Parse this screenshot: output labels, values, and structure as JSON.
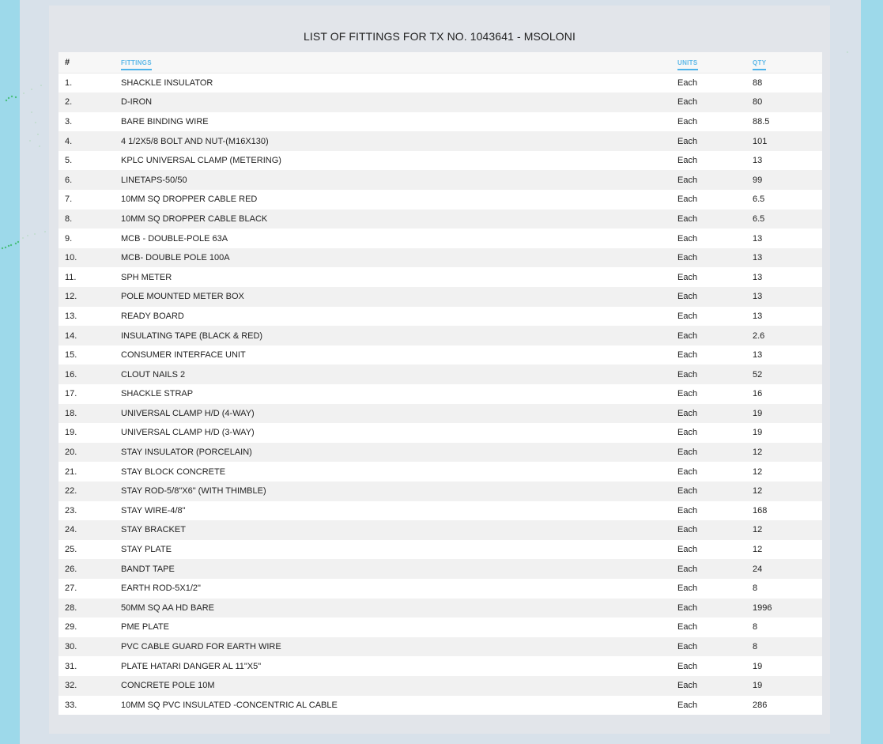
{
  "page": {
    "title": "LIST OF FITTINGS FOR TX NO. 1043641 - MSOLONI"
  },
  "colors": {
    "outer_background": "#9dd9ea",
    "frame_background": "#d8e1ea",
    "panel_background": "#e2e5ea",
    "header_link": "#5db8e8",
    "row_alt": "#f1f1f1"
  },
  "table": {
    "columns": {
      "num": "#",
      "fittings": "FITTINGS",
      "units": "UNITS",
      "qty": "QTY"
    },
    "rows": [
      {
        "num": "1.",
        "fitting": "SHACKLE INSULATOR",
        "unit": "Each",
        "qty": "88"
      },
      {
        "num": "2.",
        "fitting": "D-IRON",
        "unit": "Each",
        "qty": "80"
      },
      {
        "num": "3.",
        "fitting": "BARE BINDING WIRE",
        "unit": "Each",
        "qty": "88.5"
      },
      {
        "num": "4.",
        "fitting": "4 1/2X5/8 BOLT AND NUT-(M16X130)",
        "unit": "Each",
        "qty": "101"
      },
      {
        "num": "5.",
        "fitting": "KPLC UNIVERSAL CLAMP (METERING)",
        "unit": "Each",
        "qty": "13"
      },
      {
        "num": "6.",
        "fitting": "LINETAPS-50/50",
        "unit": "Each",
        "qty": "99"
      },
      {
        "num": "7.",
        "fitting": "10MM SQ DROPPER CABLE RED",
        "unit": "Each",
        "qty": "6.5"
      },
      {
        "num": "8.",
        "fitting": "10MM SQ DROPPER CABLE BLACK",
        "unit": "Each",
        "qty": "6.5"
      },
      {
        "num": "9.",
        "fitting": "MCB - DOUBLE-POLE 63A",
        "unit": "Each",
        "qty": "13"
      },
      {
        "num": "10.",
        "fitting": "MCB- DOUBLE POLE 100A",
        "unit": "Each",
        "qty": "13"
      },
      {
        "num": "11.",
        "fitting": "SPH METER",
        "unit": "Each",
        "qty": "13"
      },
      {
        "num": "12.",
        "fitting": "POLE MOUNTED METER BOX",
        "unit": "Each",
        "qty": "13"
      },
      {
        "num": "13.",
        "fitting": "READY BOARD",
        "unit": "Each",
        "qty": "13"
      },
      {
        "num": "14.",
        "fitting": "INSULATING TAPE (BLACK & RED)",
        "unit": "Each",
        "qty": "2.6"
      },
      {
        "num": "15.",
        "fitting": "CONSUMER INTERFACE UNIT",
        "unit": "Each",
        "qty": "13"
      },
      {
        "num": "16.",
        "fitting": "CLOUT NAILS 2",
        "unit": "Each",
        "qty": "52"
      },
      {
        "num": "17.",
        "fitting": "SHACKLE STRAP",
        "unit": "Each",
        "qty": "16"
      },
      {
        "num": "18.",
        "fitting": "UNIVERSAL CLAMP H/D (4-WAY)",
        "unit": "Each",
        "qty": "19"
      },
      {
        "num": "19.",
        "fitting": "UNIVERSAL CLAMP H/D (3-WAY)",
        "unit": "Each",
        "qty": "19"
      },
      {
        "num": "20.",
        "fitting": "STAY INSULATOR (PORCELAIN)",
        "unit": "Each",
        "qty": "12"
      },
      {
        "num": "21.",
        "fitting": "STAY BLOCK CONCRETE",
        "unit": "Each",
        "qty": "12"
      },
      {
        "num": "22.",
        "fitting": "STAY ROD-5/8\"X6\" (WITH THIMBLE)",
        "unit": "Each",
        "qty": "12"
      },
      {
        "num": "23.",
        "fitting": "STAY WIRE-4/8\"",
        "unit": "Each",
        "qty": "168"
      },
      {
        "num": "24.",
        "fitting": "STAY BRACKET",
        "unit": "Each",
        "qty": "12"
      },
      {
        "num": "25.",
        "fitting": "STAY PLATE",
        "unit": "Each",
        "qty": "12"
      },
      {
        "num": "26.",
        "fitting": "BANDT TAPE",
        "unit": "Each",
        "qty": "24"
      },
      {
        "num": "27.",
        "fitting": "EARTH ROD-5X1/2\"",
        "unit": "Each",
        "qty": "8"
      },
      {
        "num": "28.",
        "fitting": "50MM SQ AA HD BARE",
        "unit": "Each",
        "qty": "1996"
      },
      {
        "num": "29.",
        "fitting": "PME PLATE",
        "unit": "Each",
        "qty": "8"
      },
      {
        "num": "30.",
        "fitting": "PVC CABLE GUARD FOR EARTH WIRE",
        "unit": "Each",
        "qty": "8"
      },
      {
        "num": "31.",
        "fitting": "PLATE HATARI DANGER AL 11\"X5\"",
        "unit": "Each",
        "qty": "19"
      },
      {
        "num": "32.",
        "fitting": "CONCRETE POLE 10M",
        "unit": "Each",
        "qty": "19"
      },
      {
        "num": "33.",
        "fitting": "10MM SQ PVC INSULATED -CONCENTRIC AL CABLE",
        "unit": "Each",
        "qty": "286"
      }
    ]
  }
}
